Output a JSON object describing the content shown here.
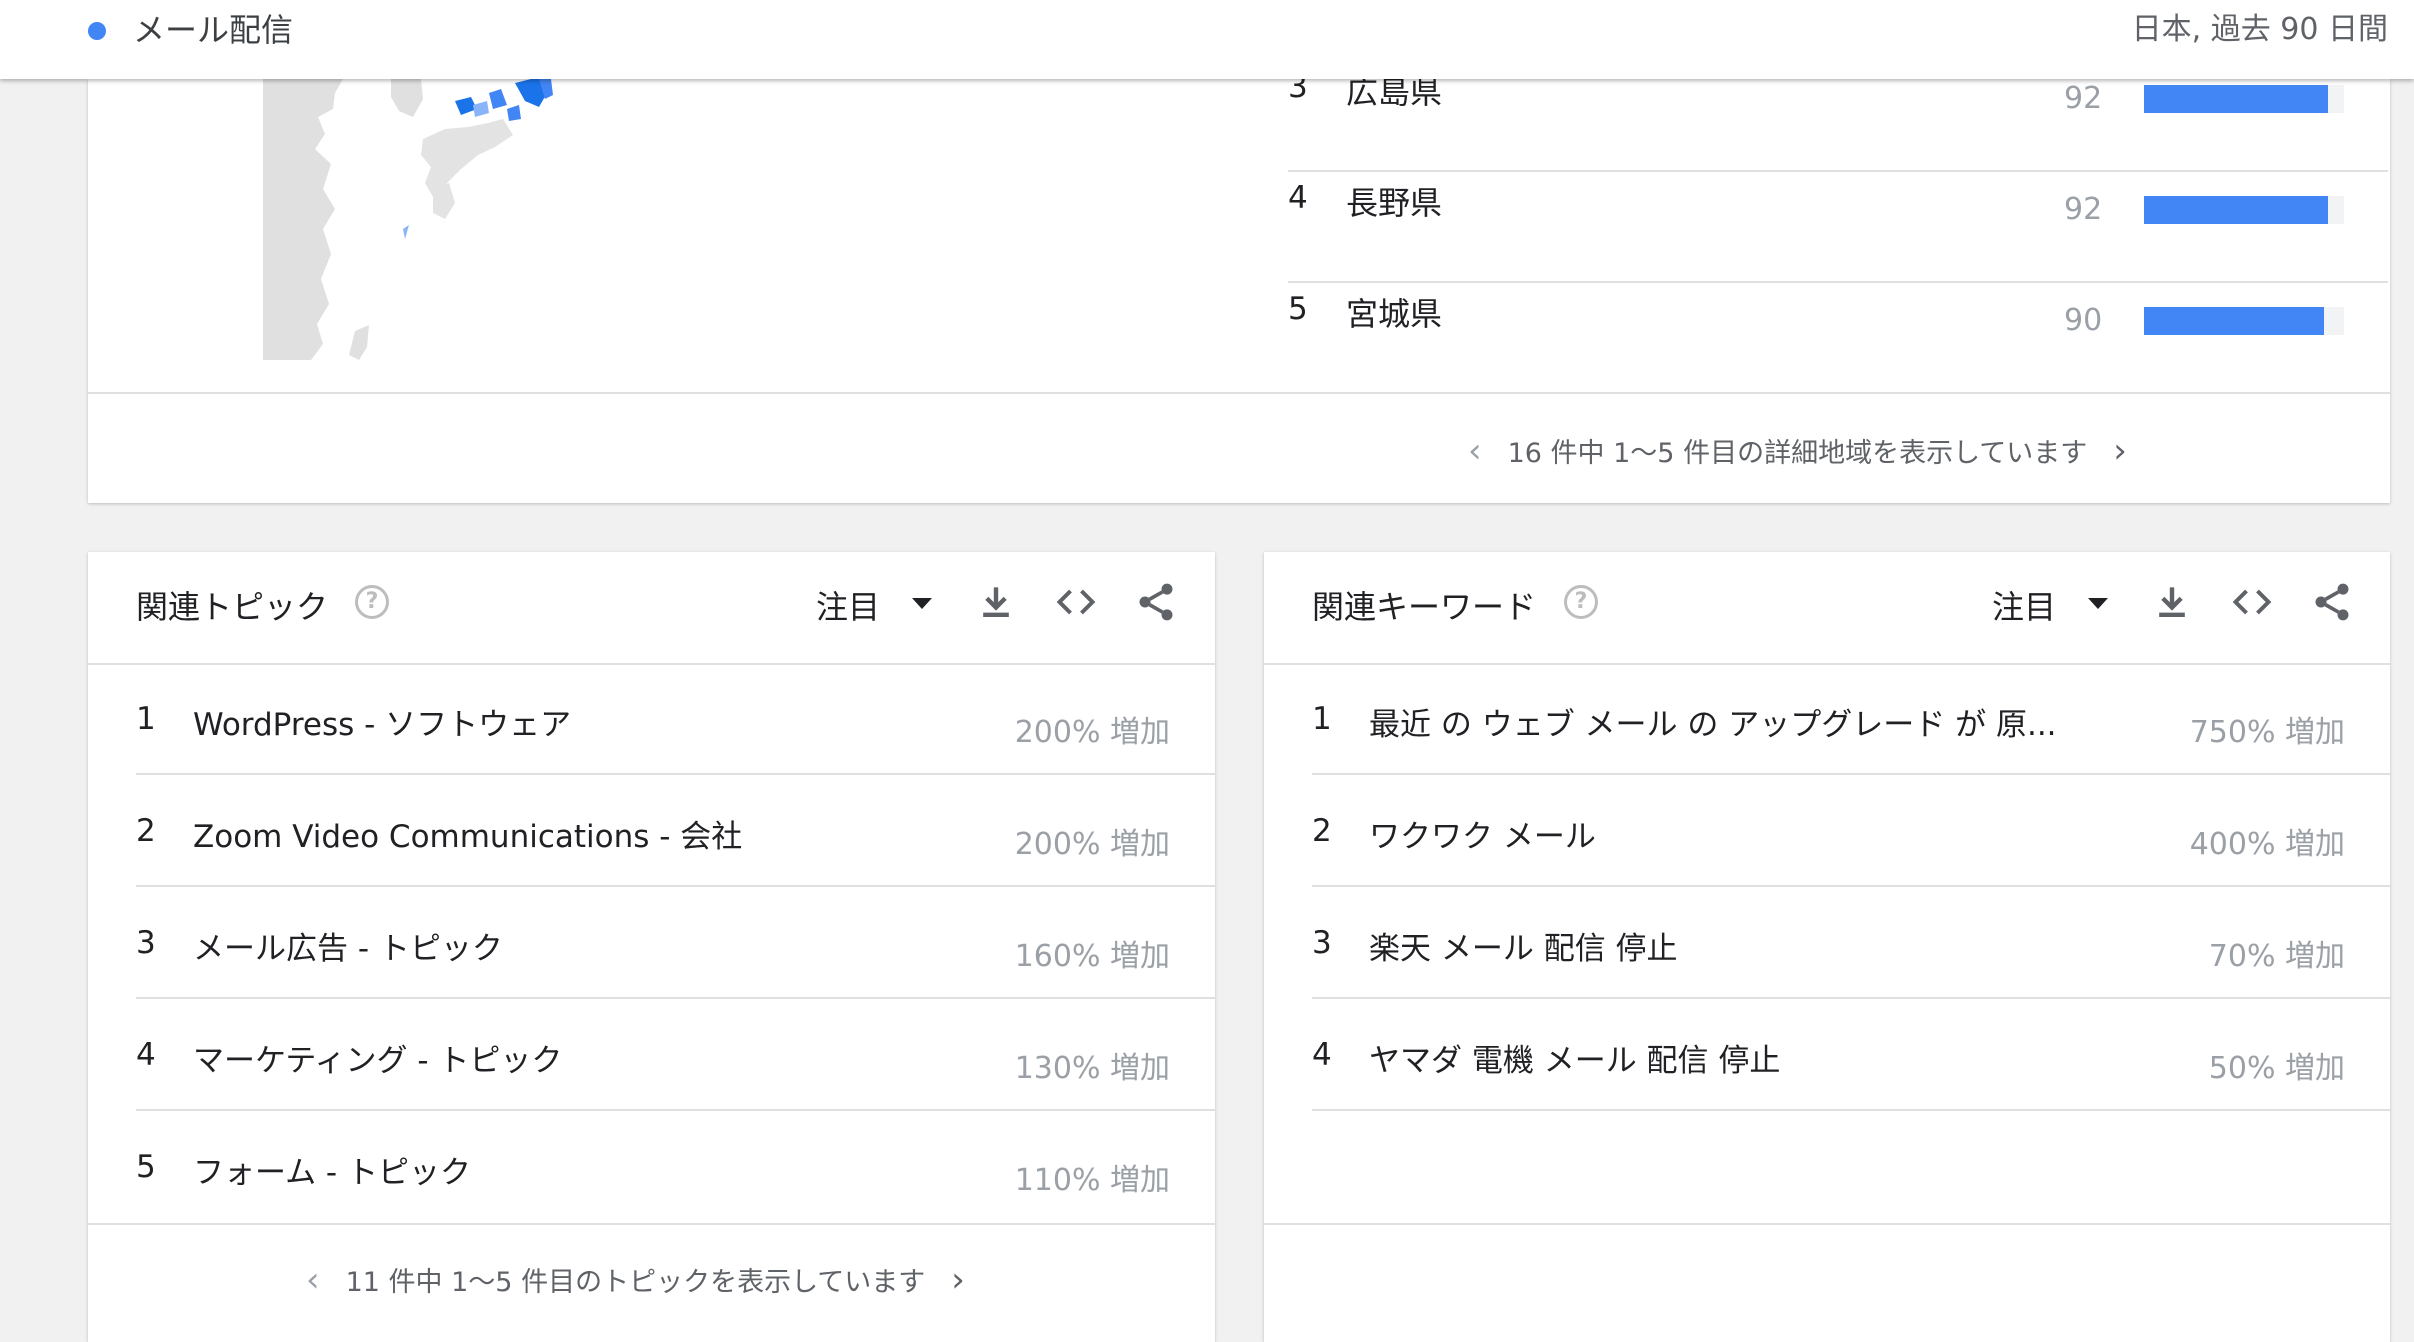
{
  "header": {
    "term": "メール配信",
    "term_color": "#4285f4",
    "meta": "日本, 過去 90 日間"
  },
  "regions": {
    "items": [
      {
        "rank": "3",
        "name": "広島県",
        "value": "92",
        "value_num": 92
      },
      {
        "rank": "4",
        "name": "長野県",
        "value": "92",
        "value_num": 92
      },
      {
        "rank": "5",
        "name": "宮城県",
        "value": "90",
        "value_num": 90
      }
    ],
    "bar_color": "#4285f4",
    "pager_text": "16 件中 1〜5 件目の詳細地域を表示しています"
  },
  "related_topics": {
    "title": "関連トピック",
    "sort_label": "注目",
    "items": [
      {
        "rank": "1",
        "label": "WordPress - ソフトウェア",
        "growth": "200% 増加"
      },
      {
        "rank": "2",
        "label": "Zoom Video Communications - 会社",
        "growth": "200% 増加"
      },
      {
        "rank": "3",
        "label": "メール広告 - トピック",
        "growth": "160% 増加"
      },
      {
        "rank": "4",
        "label": "マーケティング - トピック",
        "growth": "130% 増加"
      },
      {
        "rank": "5",
        "label": "フォーム - トピック",
        "growth": "110% 増加"
      }
    ],
    "pager_text": "11 件中 1〜5 件目のトピックを表示しています"
  },
  "related_queries": {
    "title": "関連キーワード",
    "sort_label": "注目",
    "items": [
      {
        "rank": "1",
        "label": "最近 の ウェブ メール の アップグレード が 原...",
        "growth": "750% 増加"
      },
      {
        "rank": "2",
        "label": "ワクワク メール",
        "growth": "400% 増加"
      },
      {
        "rank": "3",
        "label": "楽天 メール 配信 停止",
        "growth": "70% 増加"
      },
      {
        "rank": "4",
        "label": "ヤマダ 電機 メール 配信 停止",
        "growth": "50% 増加"
      }
    ]
  },
  "icons": {
    "help": "help-icon",
    "sort": "dropdown-caret-icon",
    "download": "download-icon",
    "embed": "embed-code-icon",
    "share": "share-icon",
    "prev": "chevron-left-icon",
    "next": "chevron-right-icon"
  },
  "colors": {
    "accent": "#4285f4",
    "muted": "#9aa0a6",
    "map_land": "#e0e0e0"
  }
}
